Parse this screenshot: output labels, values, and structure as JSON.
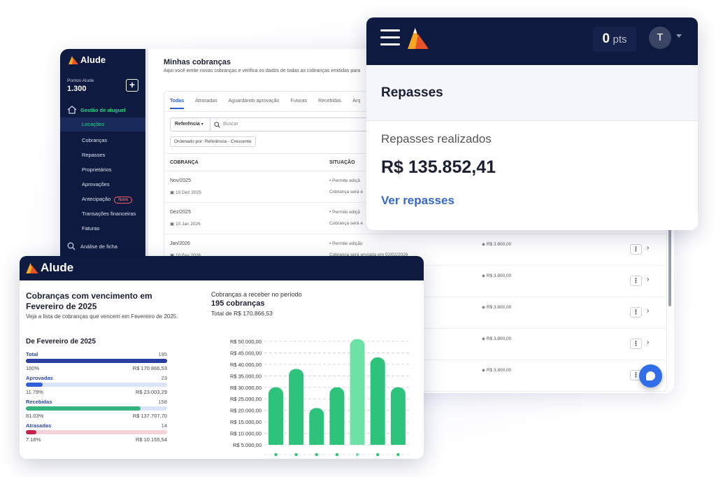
{
  "brand": {
    "name": "Alude"
  },
  "back_window": {
    "sidebar": {
      "points_label": "Pontos Alude",
      "points_value": "1.300",
      "add_icon": "plus-icon",
      "section_label": "Gestão de aluguel",
      "section_icon": "house-gear-icon",
      "items": [
        {
          "label": "Locações",
          "active": true
        },
        {
          "label": "Cobranças"
        },
        {
          "label": "Repasses"
        },
        {
          "label": "Proprietários"
        },
        {
          "label": "Aprovações"
        },
        {
          "label": "Antecipação",
          "badge": "Novo"
        },
        {
          "label": "Transações financeiras"
        },
        {
          "label": "Faturas"
        }
      ],
      "search_label": "Análise de ficha",
      "search_icon": "search-icon"
    },
    "main": {
      "title": "Minhas cobranças",
      "description": "Aqui você emite novas cobranças e verifica os dados de todas as cobranças emitidas para",
      "tabs": [
        "Todas",
        "Atrasadas",
        "Aguardando aprovação",
        "Futuras",
        "Recebidas",
        "Arq"
      ],
      "filter_select": "Referência",
      "search_placeholder": "Buscar",
      "sort_chip": "Ordenado por: Referência - Crescente",
      "columns": {
        "cobranca": "COBRANÇA",
        "situacao": "SITUAÇÃO"
      },
      "rows": [
        {
          "month": "Nov/2025",
          "date": "10 Dez 2025",
          "status": "Permite ediçã",
          "note": "Cobrança será e",
          "amount": ""
        },
        {
          "month": "Dez/2025",
          "date": "10 Jan 2026",
          "status": "Permite ediçã",
          "note": "Cobrança será e",
          "amount": ""
        },
        {
          "month": "Jan/2026",
          "date": "10 Fev 2026",
          "status": "Permite edição",
          "note": "Cobrança será enviada em 02/02/2026",
          "amount": "R$ 3.800,00"
        },
        {
          "month": "",
          "date": "",
          "status": "",
          "note": "",
          "amount": "R$ 3.800,00"
        },
        {
          "month": "",
          "date": "",
          "status": "",
          "note": "",
          "amount": "R$ 3.800,00"
        },
        {
          "month": "",
          "date": "",
          "status": "",
          "note": "",
          "amount": "R$ 3.800,00"
        },
        {
          "month": "",
          "date": "",
          "status": "",
          "note": "",
          "amount": "R$ 3.800,00"
        }
      ]
    }
  },
  "top_right_window": {
    "points_value": "0",
    "points_unit": "pts",
    "avatar_initial": "T",
    "title": "Repasses",
    "subtitle": "Repasses realizados",
    "amount": "R$ 135.852,41",
    "link": "Ver repasses"
  },
  "bottom_left_window": {
    "heading": "Cobranças com vencimento em Fevereiro de 2025",
    "description": "Veja a lista de cobranças que vencem em Fevereiro de 2025.",
    "stats_title": "De Fevereiro de 2025",
    "stats": [
      {
        "name": "Total",
        "count": "195",
        "percent": "100%",
        "value": "R$ 170.866,53",
        "fraction": 1.0,
        "color": "#2b3fa3",
        "track": "#2b3fa3"
      },
      {
        "name": "Aprovadas",
        "count": "23",
        "percent": "11.79%",
        "value": "R$ 23.003,29",
        "fraction": 0.1179,
        "color": "#2f5fd8",
        "track": "#dbe3f7"
      },
      {
        "name": "Recebidas",
        "count": "158",
        "percent": "81.03%",
        "value": "R$ 137.707,70",
        "fraction": 0.8103,
        "color": "#33b37d",
        "track": "#dbe3f7"
      },
      {
        "name": "Atrasadas",
        "count": "14",
        "percent": "7.18%",
        "value": "R$ 10.155,54",
        "fraction": 0.0718,
        "color": "#c4244a",
        "track": "#f6d3da"
      }
    ],
    "chart_head": "Cobranças a receber no período",
    "chart_count": "195 cobranças",
    "chart_total": "Total de R$ 170.866,53"
  },
  "chart_data": {
    "type": "bar",
    "title": "",
    "xlabel": "",
    "ylabel": "",
    "ylim": [
      5000,
      50000
    ],
    "yticks": [
      "R$ 5.000,00",
      "R$ 10.000,00",
      "R$ 15.000,00",
      "R$ 20.000,00",
      "R$ 25.000,00",
      "R$ 30.000,00",
      "R$ 35.000,00",
      "R$ 40.000,00",
      "R$ 45.000,00",
      "R$ 50.000,00"
    ],
    "tick_values": [
      5000,
      10000,
      15000,
      20000,
      25000,
      30000,
      35000,
      40000,
      45000,
      50000
    ],
    "values": [
      30000,
      38000,
      21000,
      30000,
      51000,
      43000,
      30000
    ],
    "highlight_index": 4,
    "colors": {
      "bar": "#2dc37b",
      "highlight": "#6ee1a6",
      "grid": "#c9ccd6",
      "axis_text": "#333333"
    }
  }
}
